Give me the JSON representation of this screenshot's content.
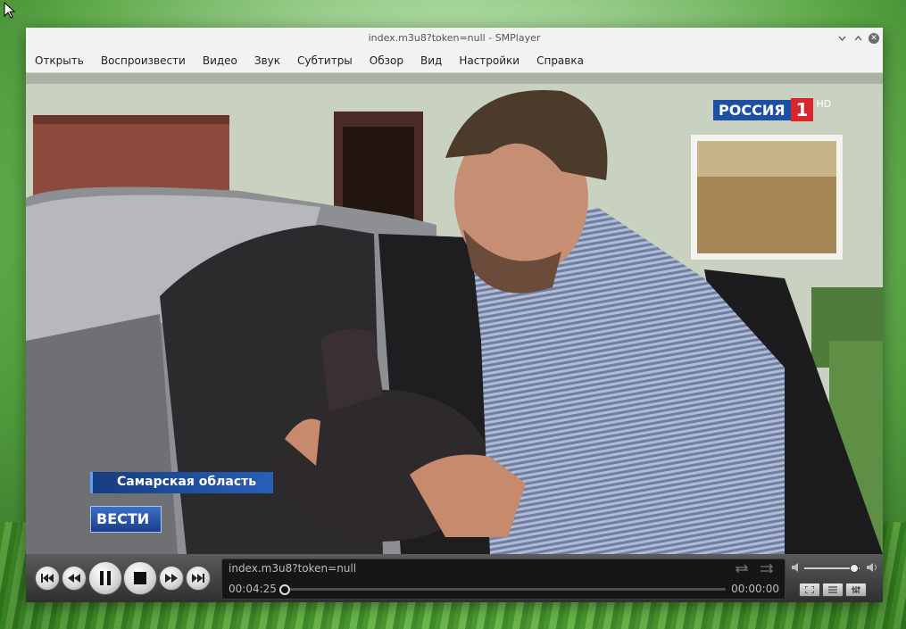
{
  "window": {
    "title": "index.m3u8?token=null - SMPlayer",
    "controls": [
      "minimize",
      "maximize",
      "close"
    ]
  },
  "menu": [
    {
      "label": "Открыть"
    },
    {
      "label": "Воспроизвести"
    },
    {
      "label": "Видео"
    },
    {
      "label": "Звук"
    },
    {
      "label": "Субтитры"
    },
    {
      "label": "Обзор"
    },
    {
      "label": "Вид"
    },
    {
      "label": "Настройки"
    },
    {
      "label": "Справка"
    }
  ],
  "video": {
    "channel_logo_text": "РОССИЯ",
    "channel_logo_number": "1",
    "channel_logo_hd": "HD",
    "caption_region": "Самарская область",
    "program_badge": "ВЕСТИ"
  },
  "player": {
    "media_title": "index.m3u8?token=null",
    "time_current": "00:04:25",
    "time_total": "00:00:00",
    "seek_position": 0,
    "volume_level": 0.9,
    "buttons": [
      "previous-icon",
      "rewind-icon",
      "pause-icon",
      "stop-icon",
      "forward-icon",
      "next-icon"
    ]
  },
  "colors": {
    "titlebar_bg": "#f2f2f2",
    "controls_bg": "#2f2f2f",
    "lower_third_blue": "#1f4e9e",
    "logo_red": "#d8262c"
  }
}
